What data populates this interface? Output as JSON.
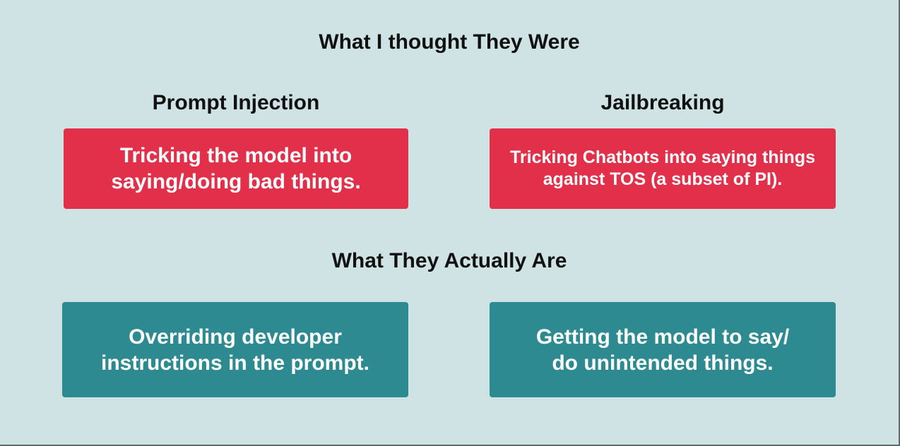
{
  "diagram": {
    "top_heading": "What I thought They Were",
    "bottom_heading": "What They Actually Are",
    "columns": [
      {
        "label": "Prompt Injection"
      },
      {
        "label": "Jailbreaking"
      }
    ],
    "thought_cards": [
      {
        "text": "Tricking the model into saying/doing bad things.",
        "color": "#e2304a"
      },
      {
        "text": "Tricking Chatbots into saying things against TOS (a subset of PI).",
        "color": "#e2304a"
      }
    ],
    "actual_cards": [
      {
        "text": "Overriding developer instructions in the prompt.",
        "color": "#2e8a91"
      },
      {
        "text": "Getting the model to say/ do unintended things.",
        "color": "#2e8a91"
      }
    ],
    "background_color": "#cfe2e4"
  }
}
